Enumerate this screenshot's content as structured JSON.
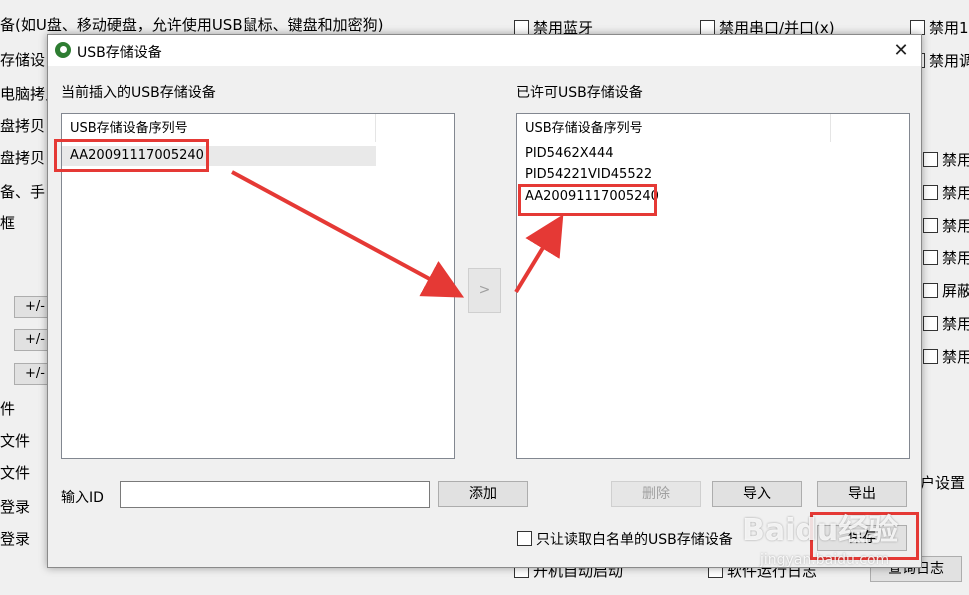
{
  "background": {
    "left_lines": [
      "备(如U盘、移动硬盘，允许使用USB鼠标、键盘和加密狗)",
      "存储设",
      "电脑拷贝",
      "盘拷贝",
      "盘拷贝",
      "备、手",
      "框"
    ],
    "left_buttons": [
      "+/-",
      "+/-",
      "+/-"
    ],
    "left_lower": [
      "件",
      "文件",
      "文件",
      "登录",
      "登录"
    ],
    "right_checks_top": [
      "禁用蓝牙",
      "禁用串口/并口(x)",
      "禁用1"
    ],
    "right_check_2": "禁用调",
    "right_checks_side": [
      "禁用",
      "禁用",
      "禁用",
      "禁用",
      "屏蔽",
      "禁用",
      "禁用"
    ],
    "right_user_settings": "户设置",
    "bottom_items": [
      "开机自动启动",
      "软件运行日志",
      "查询日志"
    ]
  },
  "dialog": {
    "title": "USB存储设备",
    "close": "✕",
    "left_panel": {
      "label": "当前插入的USB存储设备",
      "column_header": "USB存储设备序列号",
      "rows": [
        "AA20091117005240"
      ]
    },
    "transfer_button": ">",
    "right_panel": {
      "label": "已许可USB存储设备",
      "column_header": "USB存储设备序列号",
      "rows": [
        "PID5462X444",
        "PID54221VID45522",
        "AA20091117005240"
      ]
    },
    "input_label": "输入ID",
    "input_value": "",
    "add_button": "添加",
    "delete_button": "删除",
    "import_button": "导入",
    "export_button": "导出",
    "whitelist_checkbox_label": "只让读取白名单的USB存储设备",
    "save_button": "保存"
  },
  "watermark": "Baidu经验",
  "watermark_sub": "jingyan.baidu.com",
  "colors": {
    "annotation_red": "#e53935",
    "dialog_bg": "#f0f0f0",
    "selected_row": "#e9e9e9"
  }
}
